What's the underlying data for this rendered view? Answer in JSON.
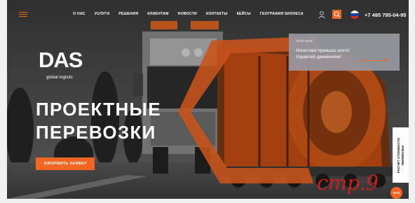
{
  "nav": {
    "items": [
      "О НАС",
      "УСЛУГИ",
      "РЕШЕНИЯ",
      "КЛИЕНТАМ",
      "НОВОСТИ",
      "КОНТАКТЫ",
      "КЕЙСЫ",
      "ГЕОГРАФИЯ БИЗНЕСА"
    ]
  },
  "header": {
    "phone": "+7 495 795-04-95",
    "language_flag": "russia-flag"
  },
  "brand": {
    "logo": "DAS",
    "tagline": "global logistic"
  },
  "hero": {
    "headline_line1": "ПРОЕКТНЫЕ",
    "headline_line2": "ПЕРЕВОЗКИ",
    "cta_label": "ОФОРМИТЬ ЗАЯВКУ"
  },
  "news": {
    "date": "03.08.2020",
    "text_line1": "Логистика превыше всего!",
    "text_line2": "Управляй движением!"
  },
  "side_tab": {
    "line1": "РАСЧЕТ СТОИМОСТИ",
    "line2": "ПЕРЕВОЗКИ"
  },
  "badge": {
    "label": "DAS"
  },
  "annotation": {
    "text": "стр.9"
  },
  "colors": {
    "accent": "#f26522",
    "dark": "#2e2e2e",
    "news_card": "#9898a2",
    "annotation": "#c91f1f"
  },
  "icons": [
    "menu-icon",
    "user-icon",
    "search-icon",
    "russia-flag-icon",
    "arrow-right-icon"
  ]
}
